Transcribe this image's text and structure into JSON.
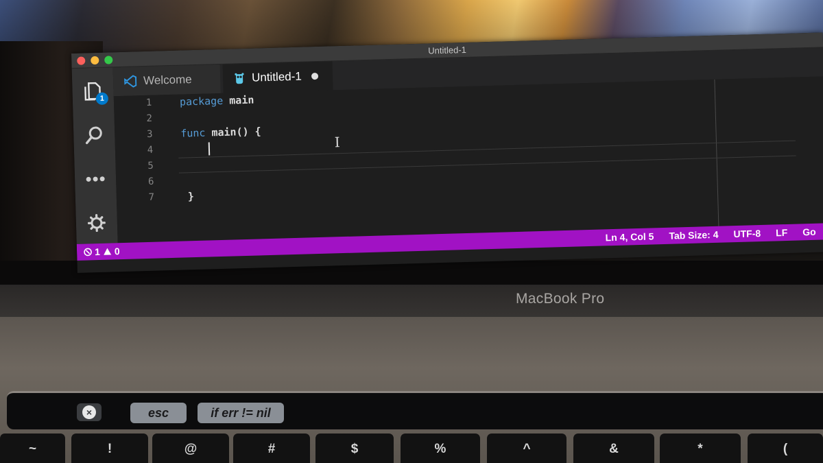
{
  "window": {
    "title": "Untitled-1"
  },
  "tabs": [
    {
      "label": "Welcome",
      "active": false
    },
    {
      "label": "Untitled-1",
      "active": true,
      "dirty": true
    }
  ],
  "activity_bar": {
    "explorer_badge": "1",
    "items": [
      "files-icon",
      "search-icon",
      "more-icon",
      "gear-icon"
    ]
  },
  "editor": {
    "line_numbers": [
      "1",
      "2",
      "3",
      "4",
      "5",
      "6",
      "7"
    ],
    "lines": [
      {
        "tokens": [
          {
            "text": "package",
            "kind": "keyword"
          },
          {
            "text": " main",
            "kind": "plain"
          }
        ]
      },
      {
        "tokens": []
      },
      {
        "tokens": [
          {
            "text": "func",
            "kind": "keyword"
          },
          {
            "text": " main() {",
            "kind": "plain"
          }
        ]
      },
      {
        "tokens": []
      },
      {
        "tokens": []
      },
      {
        "tokens": []
      },
      {
        "tokens": [
          {
            "text": "}",
            "kind": "plain"
          }
        ]
      }
    ]
  },
  "status_bar": {
    "errors": "1",
    "warnings": "0",
    "position": "Ln 4, Col 5",
    "tab_size": "Tab Size: 4",
    "encoding": "UTF-8",
    "eol": "LF",
    "language": "Go",
    "color": "#a112c4"
  },
  "device": {
    "brand": "MacBook Pro",
    "touch_bar": {
      "esc": "esc",
      "suggestion": "if err != nil"
    },
    "keys": [
      "~",
      "!",
      "@",
      "#",
      "$",
      "%",
      "^",
      "&",
      "*",
      "("
    ]
  }
}
